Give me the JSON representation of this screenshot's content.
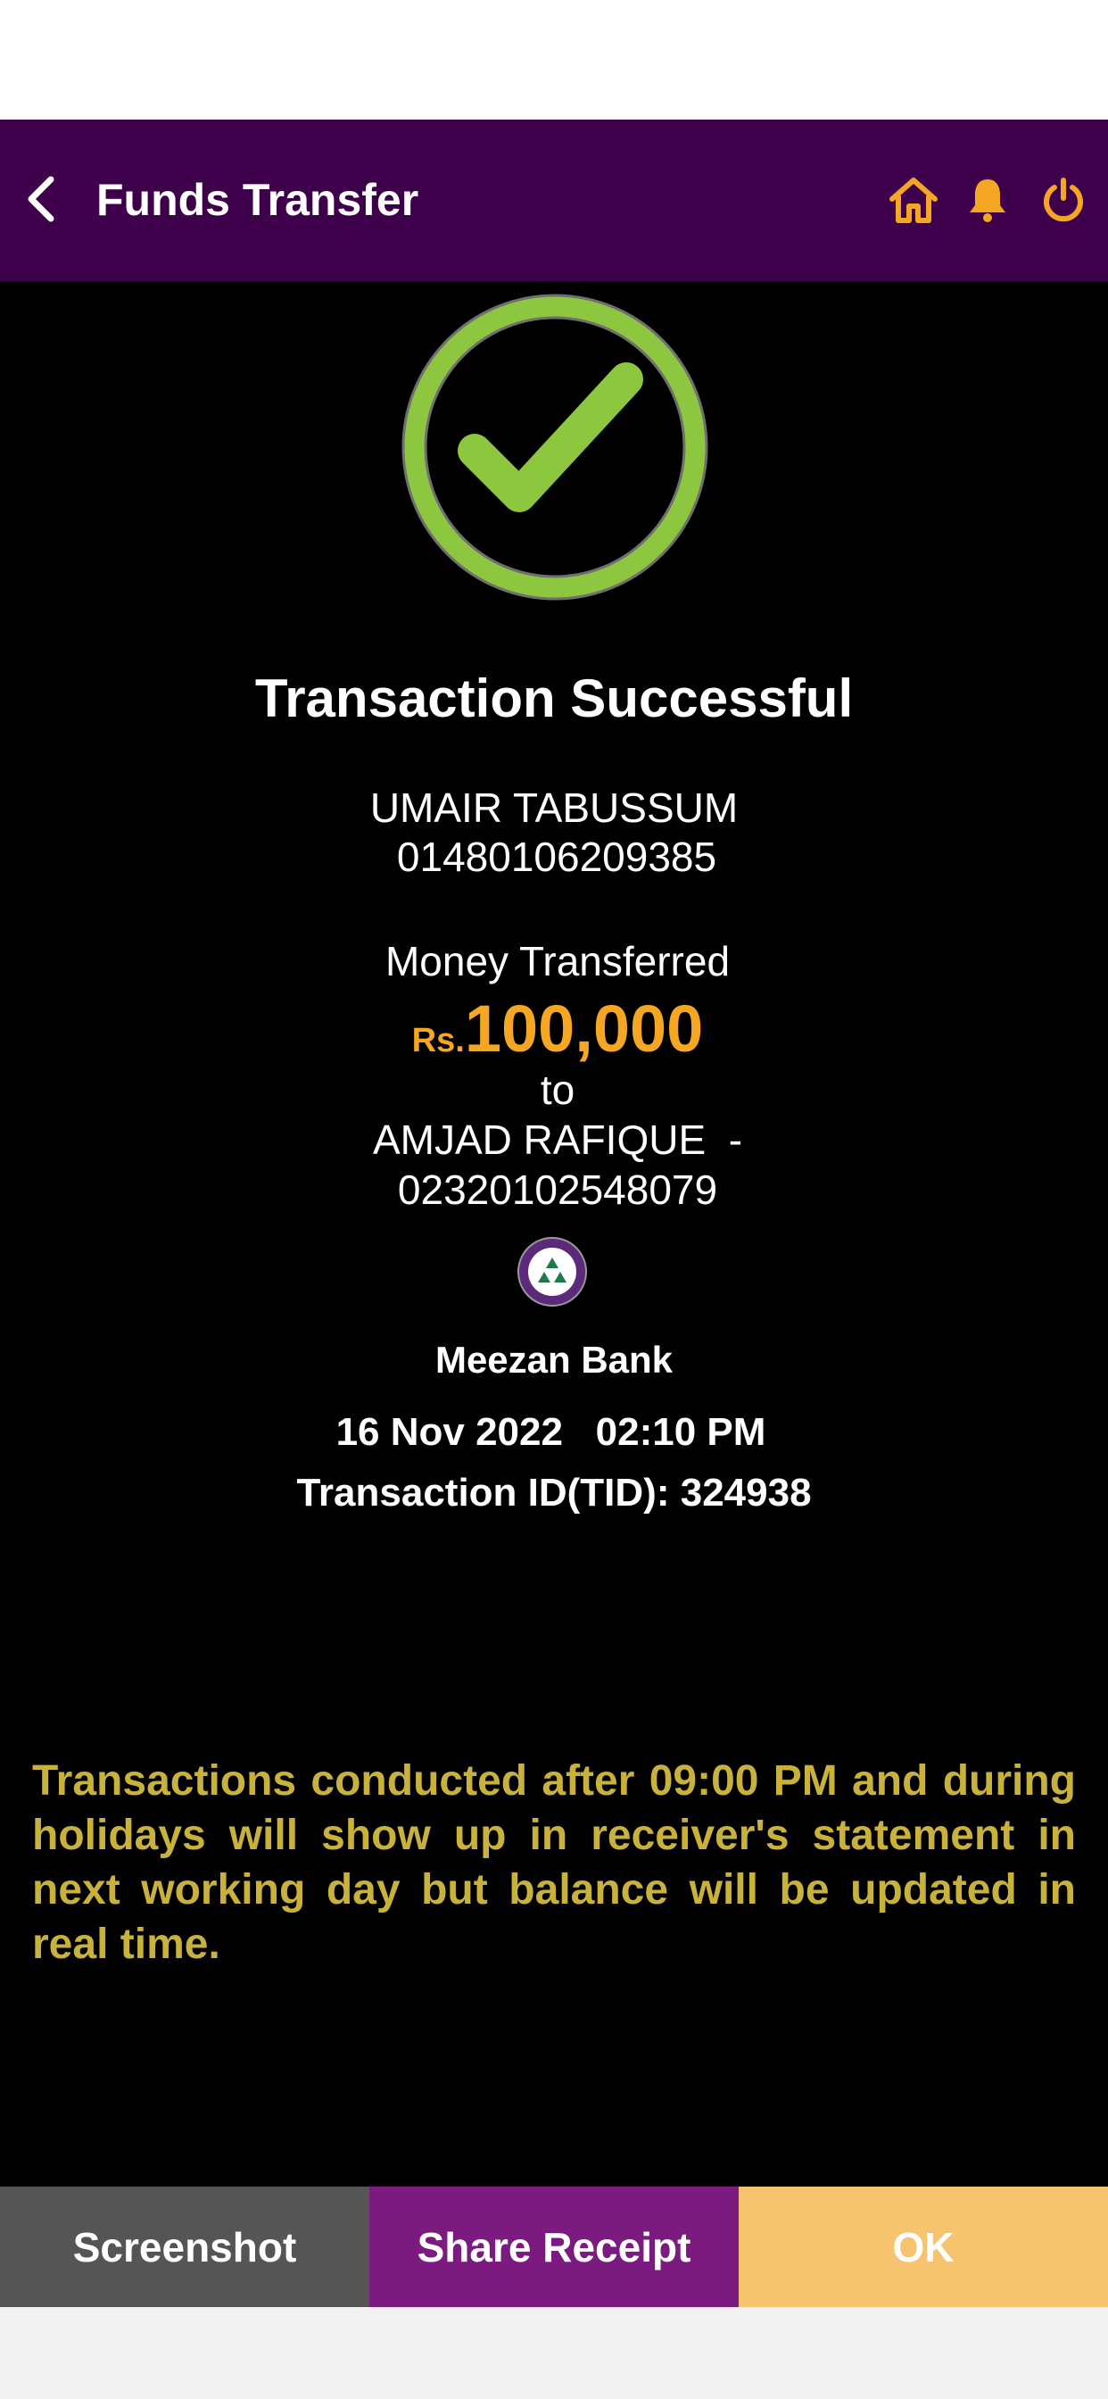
{
  "header": {
    "title": "Funds Transfer",
    "back_icon": "chevron-left-icon",
    "home_icon": "home-icon",
    "bell_icon": "bell-icon",
    "power_icon": "power-icon",
    "accent_color": "#f5a623",
    "background_color": "#3e004a"
  },
  "status": {
    "icon": "check-circle-icon",
    "title": "Transaction Successful",
    "color": "#8dc63f"
  },
  "sender": {
    "name": "UMAIR TABUSSUM",
    "account": "01480106209385"
  },
  "transfer": {
    "label": "Money Transferred",
    "currency": "Rs.",
    "amount": "100,000",
    "to_label": "to",
    "recipient_name": "AMJAD RAFIQUE  -",
    "recipient_account": "02320102548079",
    "bank_logo_icon": "meezan-bank-logo",
    "bank_name": "Meezan Bank"
  },
  "meta": {
    "date": "16 Nov 2022",
    "time": "02:10 PM",
    "tid_label": "Transaction ID(TID):",
    "tid_value": "324938"
  },
  "disclaimer": "Transactions conducted after 09:00 PM and during holidays will show up in receiver's statement in next working day but balance will be updated in real time.",
  "actions": {
    "screenshot_label": "Screenshot",
    "share_label": "Share Receipt",
    "ok_label": "OK"
  }
}
